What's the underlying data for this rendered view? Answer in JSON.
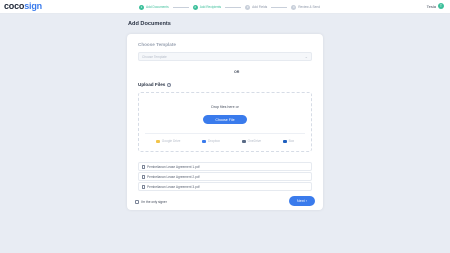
{
  "app": {
    "logo_prefix": "coco",
    "logo_accent": "sign"
  },
  "steps": [
    {
      "num": "1",
      "label": "Add Documents",
      "state": "done"
    },
    {
      "num": "2",
      "label": "Add Recipients",
      "state": "active"
    },
    {
      "num": "3",
      "label": "Add Fields",
      "state": "todo"
    },
    {
      "num": "4",
      "label": "Review & Send",
      "state": "todo"
    }
  ],
  "user": {
    "name": "Tesla",
    "initial": "T"
  },
  "page": {
    "title": "Add Documents"
  },
  "template": {
    "title": "Choose Template",
    "placeholder": "Choose Template",
    "or_text": "OR"
  },
  "upload": {
    "title": "Upload Files",
    "help_glyph": "?",
    "drop_text": "Drop files here or",
    "choose_label": "Choose File",
    "sources": [
      {
        "name": "google-drive",
        "label": "Google Drive",
        "color": "#f2c44a"
      },
      {
        "name": "dropbox",
        "label": "Dropbox",
        "color": "#3a7bec"
      },
      {
        "name": "onedrive",
        "label": "OneDrive",
        "color": "#5a6b86"
      },
      {
        "name": "box",
        "label": "Box",
        "color": "#1f5fbf"
      }
    ]
  },
  "files": [
    "Pembelianan Lease Agreement 1.pdf",
    "Pembelianan Lease Agreement 2.pdf",
    "Pembelianan Lease Agreement 3.pdf"
  ],
  "signer": {
    "label": "I'm the only signer"
  },
  "next": {
    "label": "Next ›"
  },
  "colors": {
    "accent": "#3a7bec",
    "success": "#3bbf9a"
  }
}
